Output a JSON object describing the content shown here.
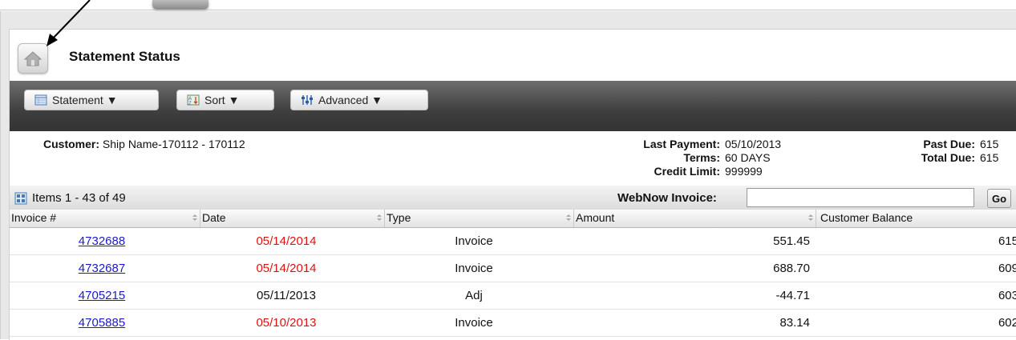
{
  "header": {
    "title": "Statement Status"
  },
  "toolbar": {
    "statement_label": "Statement ▼",
    "sort_label": "Sort ▼",
    "advanced_label": "Advanced ▼"
  },
  "info": {
    "customer_label": "Customer:",
    "customer_value": "Ship Name-170112 - 170112",
    "last_payment_label": "Last Payment:",
    "last_payment_value": "05/10/2013",
    "terms_label": "Terms:",
    "terms_value": "60 DAYS",
    "credit_limit_label": "Credit Limit:",
    "credit_limit_value": "999999",
    "past_due_label": "Past Due:",
    "past_due_value": "615",
    "total_due_label": "Total Due:",
    "total_due_value": "615"
  },
  "items_bar": {
    "items_text": "Items 1 - 43 of 49",
    "webnow_label": "WebNow Invoice:",
    "webnow_value": "",
    "go_label": "Go"
  },
  "table": {
    "columns": [
      "Invoice #",
      "Date",
      "Type",
      "Amount",
      "Customer Balance"
    ],
    "rows": [
      {
        "invoice": "4732688",
        "date": "05/14/2014",
        "type": "Invoice",
        "amount": "551.45",
        "balance": "615"
      },
      {
        "invoice": "4732687",
        "date": "05/14/2014",
        "type": "Invoice",
        "amount": "688.70",
        "balance": "609"
      },
      {
        "invoice": "4705215",
        "date": "05/11/2013",
        "type": "Adj",
        "amount": "-44.71",
        "balance": "603"
      },
      {
        "invoice": "4705885",
        "date": "05/10/2013",
        "type": "Invoice",
        "amount": "83.14",
        "balance": "602"
      }
    ]
  },
  "colors": {
    "overdue_date": "#e01010",
    "link": "#1a1acc",
    "toolbar_dark": "#3f3f3f"
  },
  "icons": [
    "home-icon",
    "statement-icon",
    "sort-icon",
    "advanced-icon",
    "items-icon",
    "sort-arrows-icon",
    "pointer-arrow-icon"
  ]
}
